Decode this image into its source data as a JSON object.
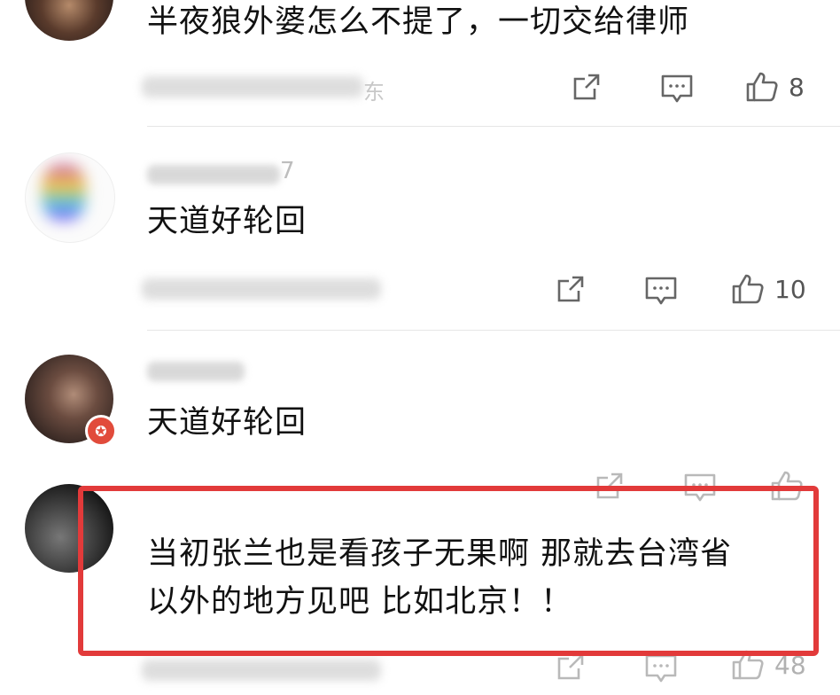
{
  "comments": [
    {
      "text": "半夜狼外婆怎么不提了，一切交给律师",
      "likes": "8",
      "username_visible": "",
      "meta_visible": "东"
    },
    {
      "text": "天道好轮回",
      "likes": "10",
      "username_visible": "7",
      "meta_visible": ""
    },
    {
      "text": "天道好轮回",
      "likes": "",
      "username_visible": "",
      "meta_visible": ""
    },
    {
      "text_line1": "当初张兰也是看孩子无果啊 那就去台湾省",
      "text_line2": "以外的地方见吧  比如北京！！",
      "likes": "48"
    }
  ],
  "icons": {
    "share": "share-icon",
    "reply": "comment-icon",
    "like": "thumbs-up-icon",
    "badge": "star-badge-icon"
  },
  "colors": {
    "highlight": "#e23a3a",
    "badge": "#e14b3b",
    "icon": "#666666"
  }
}
